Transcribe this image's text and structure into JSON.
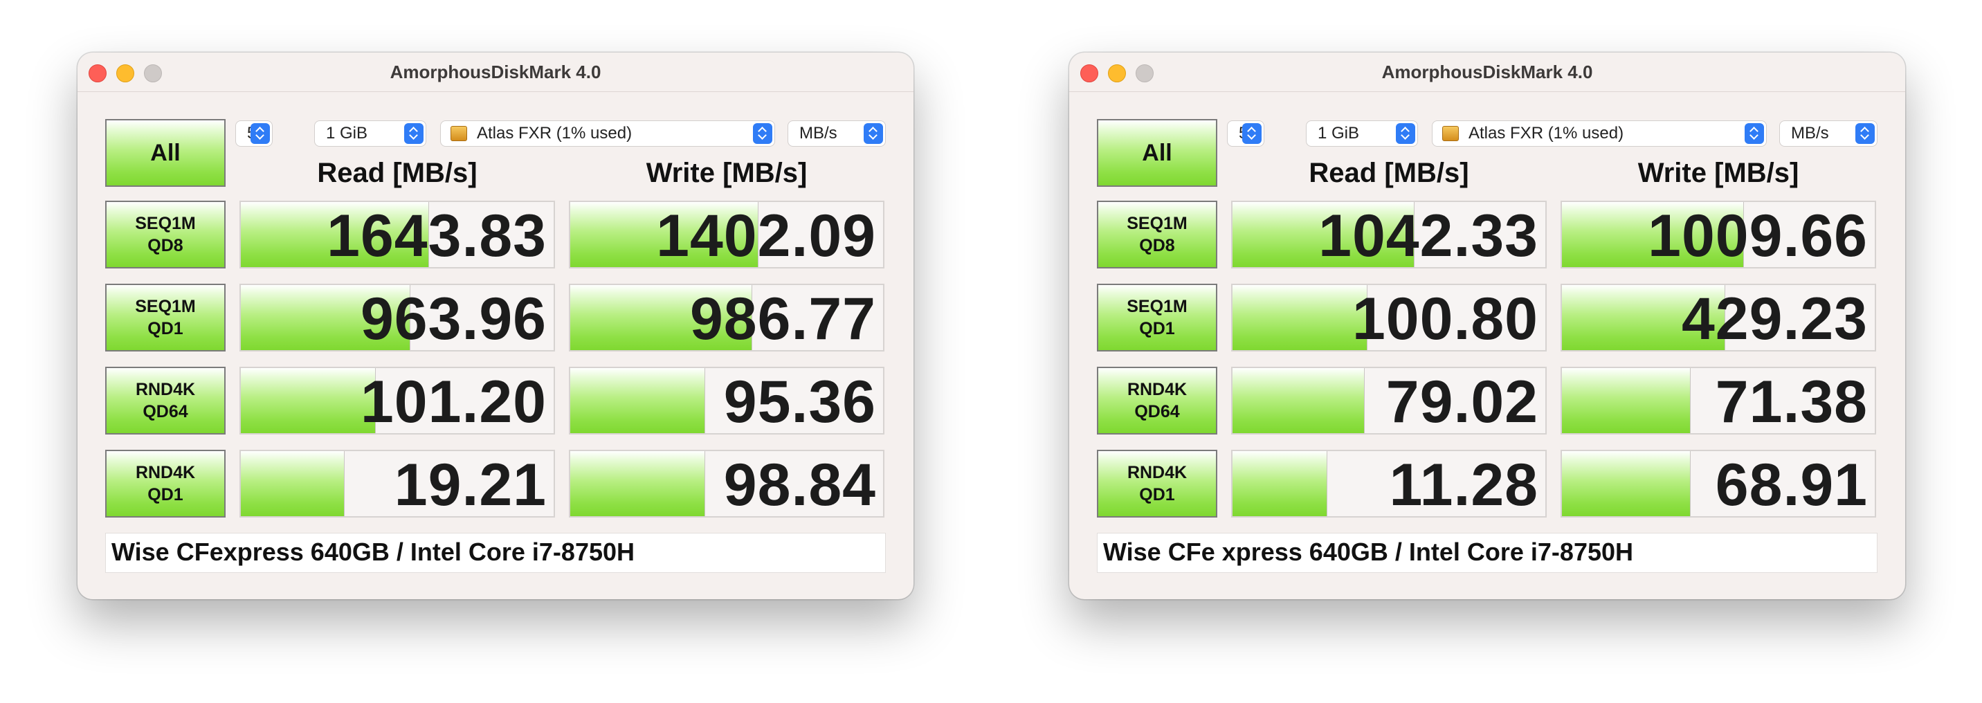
{
  "windows": [
    {
      "title": "AmorphousDiskMark 4.0",
      "all_button": "All",
      "count": "5",
      "size": "1 GiB",
      "drive": "Atlas FXR (1% used)",
      "unit": "MB/s",
      "read_header": "Read [MB/s]",
      "write_header": "Write [MB/s]",
      "comment": "Wise CFexpress 640GB / Intel Core i7-8750H",
      "rows": [
        {
          "label1": "SEQ1M",
          "label2": "QD8",
          "read": "1643.83",
          "write": "1402.09",
          "read_fill": 0.6,
          "write_fill": 0.6
        },
        {
          "label1": "SEQ1M",
          "label2": "QD1",
          "read": "963.96",
          "write": "986.77",
          "read_fill": 0.54,
          "write_fill": 0.58
        },
        {
          "label1": "RND4K",
          "label2": "QD64",
          "read": "101.20",
          "write": "95.36",
          "read_fill": 0.43,
          "write_fill": 0.43
        },
        {
          "label1": "RND4K",
          "label2": "QD1",
          "read": "19.21",
          "write": "98.84",
          "read_fill": 0.33,
          "write_fill": 0.43
        }
      ]
    },
    {
      "title": "AmorphousDiskMark 4.0",
      "all_button": "All",
      "count": "5",
      "size": "1 GiB",
      "drive": "Atlas FXR (1% used)",
      "unit": "MB/s",
      "read_header": "Read [MB/s]",
      "write_header": "Write [MB/s]",
      "comment": "Wise CFe xpress 640GB / Intel Core i7-8750H",
      "rows": [
        {
          "label1": "SEQ1M",
          "label2": "QD8",
          "read": "1042.33",
          "write": "1009.66",
          "read_fill": 0.58,
          "write_fill": 0.58
        },
        {
          "label1": "SEQ1M",
          "label2": "QD1",
          "read": "100.80",
          "write": "429.23",
          "read_fill": 0.43,
          "write_fill": 0.52
        },
        {
          "label1": "RND4K",
          "label2": "QD64",
          "read": "79.02",
          "write": "71.38",
          "read_fill": 0.42,
          "write_fill": 0.41
        },
        {
          "label1": "RND4K",
          "label2": "QD1",
          "read": "11.28",
          "write": "68.91",
          "read_fill": 0.3,
          "write_fill": 0.41
        }
      ]
    }
  ],
  "colors": {
    "accent_blue": "#2f7cf6",
    "bar_green": "#8fe046",
    "close": "#fe5f57",
    "minimize": "#febc2e"
  }
}
